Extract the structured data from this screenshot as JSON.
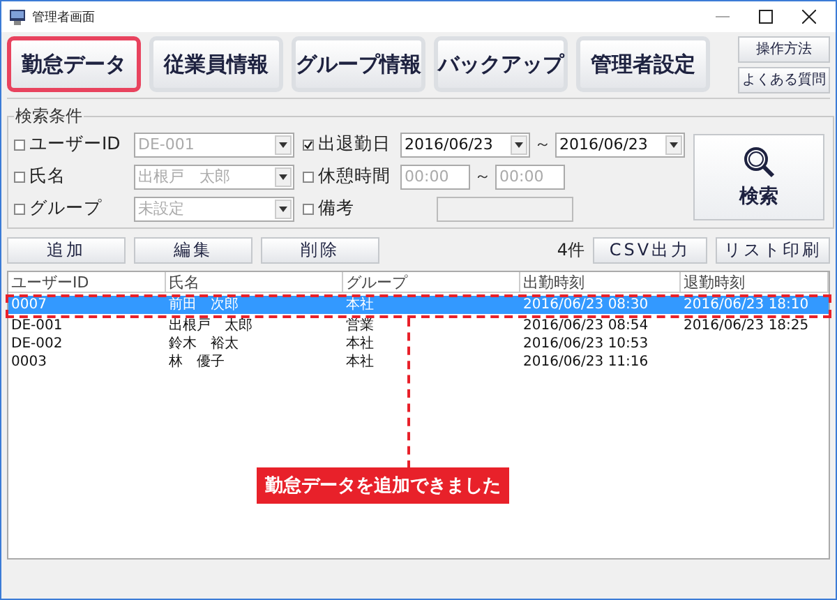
{
  "window": {
    "title": "管理者画面"
  },
  "nav": {
    "tabs": [
      {
        "label": "勤怠データ",
        "selected": true
      },
      {
        "label": "従業員情報",
        "selected": false
      },
      {
        "label": "グループ情報",
        "selected": false
      },
      {
        "label": "バックアップ",
        "selected": false
      },
      {
        "label": "管理者設定",
        "selected": false
      }
    ],
    "side_buttons": [
      "操作方法",
      "よくある質問"
    ]
  },
  "search": {
    "title": "検索条件",
    "left_fields": [
      {
        "kind": "combo",
        "label": "ユーザーID",
        "checked": false,
        "value": "DE-001"
      },
      {
        "kind": "combo",
        "label": "氏名",
        "checked": false,
        "value": "出根戸　太郎"
      },
      {
        "kind": "combo",
        "label": "グループ",
        "checked": false,
        "value": "未設定"
      }
    ],
    "right_fields": [
      {
        "kind": "date_range",
        "label": "出退勤日",
        "checked": true,
        "from": "2016/06/23",
        "separator": "～",
        "to": "2016/06/23"
      },
      {
        "kind": "time_range",
        "label": "休憩時間",
        "checked": false,
        "from": "00:00",
        "separator": "～",
        "to": "00:00"
      },
      {
        "kind": "text",
        "label": "備考",
        "checked": false
      }
    ],
    "search_button": "検索"
  },
  "actions": {
    "buttons": [
      "追加",
      "編集",
      "削除"
    ],
    "count": "4件",
    "export_buttons": [
      "CSV出力",
      "リスト印刷"
    ]
  },
  "table": {
    "columns": [
      "ユーザーID",
      "氏名",
      "グループ",
      "出勤時刻",
      "退勤時刻"
    ],
    "rows": [
      {
        "selected": true,
        "cells": [
          "0007",
          "前田　次郎",
          "本社",
          "2016/06/23 08:30",
          "2016/06/23 18:10"
        ]
      },
      {
        "selected": false,
        "cells": [
          "DE-001",
          "出根戸　太郎",
          "営業",
          "2016/06/23 08:54",
          "2016/06/23 18:25"
        ]
      },
      {
        "selected": false,
        "cells": [
          "DE-002",
          "鈴木　裕太",
          "本社",
          "2016/06/23 10:53",
          ""
        ]
      },
      {
        "selected": false,
        "cells": [
          "0003",
          "林　優子",
          "本社",
          "2016/06/23 11:16",
          ""
        ]
      }
    ]
  },
  "annotation": {
    "text": "勤怠データを追加できました"
  }
}
